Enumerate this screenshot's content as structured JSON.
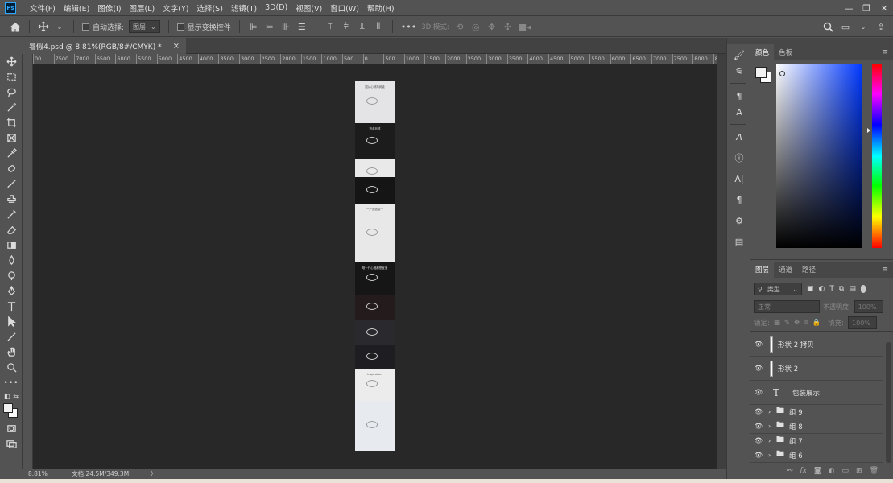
{
  "app": {
    "logo_text": "Ps"
  },
  "menu": [
    "文件(F)",
    "编辑(E)",
    "图像(I)",
    "图层(L)",
    "文字(Y)",
    "选择(S)",
    "滤镜(T)",
    "3D(D)",
    "视图(V)",
    "窗口(W)",
    "帮助(H)"
  ],
  "window_controls": [
    "—",
    "❐",
    "✕"
  ],
  "options": {
    "auto_select_label": "自动选择:",
    "auto_select_value": "图层",
    "show_transform_label": "显示变换控件",
    "mode_3d_label": "3D 模式:"
  },
  "document": {
    "tab_title": "暑假4.psd @ 8.81%(RGB/8#/CMYK) *",
    "close": "×"
  },
  "ruler": [
    "00",
    "7500",
    "7000",
    "6500",
    "6000",
    "5500",
    "5000",
    "4500",
    "4000",
    "3500",
    "3000",
    "2500",
    "2000",
    "1500",
    "1000",
    "500",
    "0",
    "500",
    "1000",
    "1500",
    "2000",
    "2500",
    "3000",
    "3500",
    "4000",
    "4500",
    "5000",
    "5500",
    "6000",
    "6500",
    "7000",
    "7500",
    "8000",
    "8500"
  ],
  "status": {
    "zoom": "8.81%",
    "doc": "文档:24.5M/349.3M",
    "arrow": "〉"
  },
  "color_panel": {
    "tabs": [
      "颜色",
      "色板"
    ]
  },
  "layers_panel": {
    "tabs": [
      "图层",
      "通道",
      "路径"
    ],
    "kind_filter": "类型",
    "blend_mode": "正常",
    "opacity_label": "不透明度:",
    "opacity_value": "100%",
    "lock_label": "锁定:",
    "fill_label": "填充:",
    "fill_value": "100%",
    "layers": [
      {
        "name": "形状 2 拷贝",
        "type": "shape"
      },
      {
        "name": "形状 2",
        "type": "shape"
      },
      {
        "name": "包装展示",
        "type": "text"
      },
      {
        "name": "组 9",
        "type": "group"
      },
      {
        "name": "组 8",
        "type": "group"
      },
      {
        "name": "组 7",
        "type": "group"
      },
      {
        "name": "组 6",
        "type": "group"
      }
    ],
    "text_layer_icon": "T",
    "footer_icons": [
      "link-icon",
      "fx-icon",
      "mask-icon",
      "adjustment-icon",
      "folder-icon",
      "new-layer-icon",
      "trash-icon"
    ]
  },
  "artboard_sections": [
    {
      "color": "#e4e4e6",
      "text": "国从心精简润级"
    },
    {
      "color": "#1c1c1c",
      "text": "铂金钻戒"
    },
    {
      "color": "#e9e9e9",
      "text": ""
    },
    {
      "color": "#151515",
      "text": ""
    },
    {
      "color": "#e8e8e8",
      "text": "一产品信息一"
    },
    {
      "color": "#161616",
      "text": "唯一开心晒都是宝宝"
    },
    {
      "color": "#241c1c",
      "text": ""
    },
    {
      "color": "#2a2a2e",
      "text": ""
    },
    {
      "color": "#1e1e22",
      "text": ""
    },
    {
      "color": "#ececec",
      "text": "Inspiration"
    },
    {
      "color": "#e7eaee",
      "text": ""
    }
  ]
}
